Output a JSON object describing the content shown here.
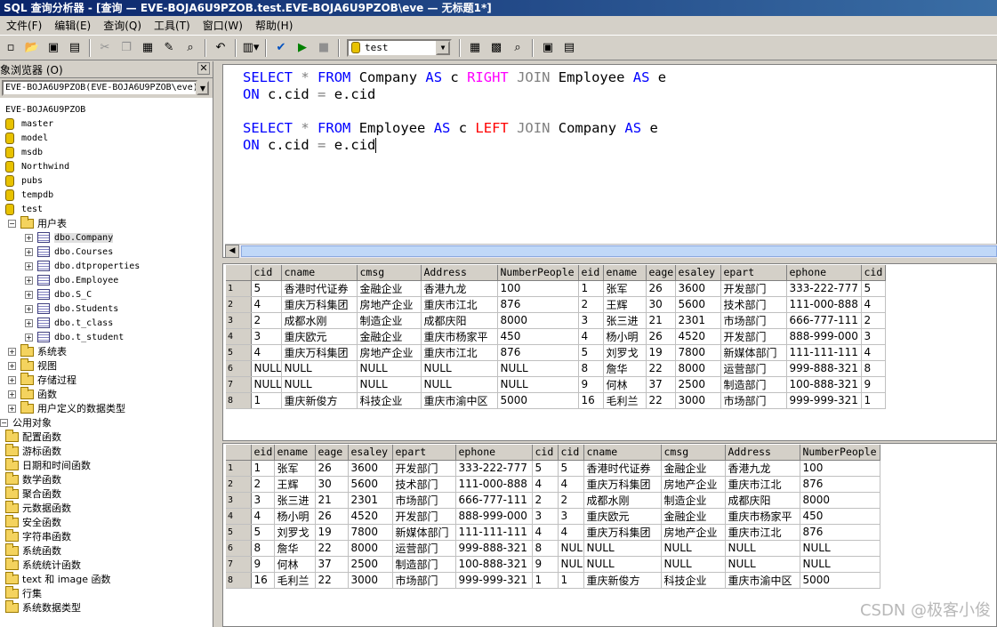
{
  "window": {
    "title": "SQL 查询分析器 - [查询 — EVE-BOJA6U9PZOB.test.EVE-BOJA6U9PZOB\\eve — 无标题1*]"
  },
  "menu": [
    "文件(F)",
    "编辑(E)",
    "查询(Q)",
    "工具(T)",
    "窗口(W)",
    "帮助(H)"
  ],
  "toolbar": {
    "database": "test"
  },
  "browser": {
    "title": "象浏览器 (O)",
    "server_combo": "EVE-BOJA6U9PZOB(EVE-BOJA6U9PZOB\\eve)",
    "server": "EVE-BOJA6U9PZOB",
    "databases": [
      "master",
      "model",
      "msdb",
      "Northwind",
      "pubs",
      "tempdb",
      "test"
    ],
    "user_tables_label": "用户表",
    "tables": [
      "dbo.Company",
      "dbo.Courses",
      "dbo.dtproperties",
      "dbo.Employee",
      "dbo.S_C",
      "dbo.Students",
      "dbo.t_class",
      "dbo.t_student"
    ],
    "db_folders": [
      "系统表",
      "视图",
      "存储过程",
      "函数",
      "用户定义的数据类型"
    ],
    "common_objects": "公用对象",
    "functions": [
      "配置函数",
      "游标函数",
      "日期和时间函数",
      "数学函数",
      "聚合函数",
      "元数据函数",
      "安全函数",
      "字符串函数",
      "系统函数",
      "系统统计函数",
      "text 和 image 函数",
      "行集",
      "系统数据类型"
    ]
  },
  "query": {
    "line1": {
      "k1": "SELECT",
      "star": "*",
      "k2": "FROM",
      "t1": "Company",
      "k3": "AS",
      "a1": "c",
      "k4": "RIGHT",
      "k5": "JOIN",
      "t2": "Employee",
      "k6": "AS",
      "a2": "e"
    },
    "line2": {
      "k1": "ON",
      "cond1": "c.cid",
      "eq": "=",
      "cond2": "e.cid"
    },
    "line3": {
      "k1": "SELECT",
      "star": "*",
      "k2": "FROM",
      "t1": "Employee",
      "k3": "AS",
      "a1": "c",
      "k4": "LEFT",
      "k5": "JOIN",
      "t2": "Company",
      "k6": "AS",
      "a2": "e"
    },
    "line4": {
      "k1": "ON",
      "cond1": "c.cid",
      "eq": "=",
      "cond2": "e.cid"
    }
  },
  "result1": {
    "columns": [
      "cid",
      "cname",
      "cmsg",
      "Address",
      "NumberPeople",
      "eid",
      "ename",
      "eage",
      "esaley",
      "epart",
      "ephone",
      "cid"
    ],
    "rows": [
      [
        "1",
        "5",
        "香港时代证券",
        "金融企业",
        "香港九龙",
        "100",
        "1",
        "张军",
        "26",
        "3600",
        "开发部门",
        "333-222-777",
        "5"
      ],
      [
        "2",
        "4",
        "重庆万科集团",
        "房地产企业",
        "重庆市江北",
        "876",
        "2",
        "王辉",
        "30",
        "5600",
        "技术部门",
        "111-000-888",
        "4"
      ],
      [
        "3",
        "2",
        "成都水刚",
        "制造企业",
        "成都庆阳",
        "8000",
        "3",
        "张三进",
        "21",
        "2301",
        "市场部门",
        "666-777-111",
        "2"
      ],
      [
        "4",
        "3",
        "重庆欧元",
        "金融企业",
        "重庆市杨家平",
        "450",
        "4",
        "杨小明",
        "26",
        "4520",
        "开发部门",
        "888-999-000",
        "3"
      ],
      [
        "5",
        "4",
        "重庆万科集团",
        "房地产企业",
        "重庆市江北",
        "876",
        "5",
        "刘罗戈",
        "19",
        "7800",
        "新媒体部门",
        "111-111-111",
        "4"
      ],
      [
        "6",
        "NULL",
        "NULL",
        "NULL",
        "NULL",
        "NULL",
        "8",
        "詹华",
        "22",
        "8000",
        "运营部门",
        "999-888-321",
        "8"
      ],
      [
        "7",
        "NULL",
        "NULL",
        "NULL",
        "NULL",
        "NULL",
        "9",
        "何林",
        "37",
        "2500",
        "制造部门",
        "100-888-321",
        "9"
      ],
      [
        "8",
        "1",
        "重庆新俊方",
        "科技企业",
        "重庆市渝中区",
        "5000",
        "16",
        "毛利兰",
        "22",
        "3000",
        "市场部门",
        "999-999-321",
        "1"
      ]
    ]
  },
  "result2": {
    "columns": [
      "eid",
      "ename",
      "eage",
      "esaley",
      "epart",
      "ephone",
      "cid",
      "cid",
      "cname",
      "cmsg",
      "Address",
      "NumberPeople"
    ],
    "rows": [
      [
        "1",
        "1",
        "张军",
        "26",
        "3600",
        "开发部门",
        "333-222-777",
        "5",
        "5",
        "香港时代证券",
        "金融企业",
        "香港九龙",
        "100"
      ],
      [
        "2",
        "2",
        "王辉",
        "30",
        "5600",
        "技术部门",
        "111-000-888",
        "4",
        "4",
        "重庆万科集团",
        "房地产企业",
        "重庆市江北",
        "876"
      ],
      [
        "3",
        "3",
        "张三进",
        "21",
        "2301",
        "市场部门",
        "666-777-111",
        "2",
        "2",
        "成都水刚",
        "制造企业",
        "成都庆阳",
        "8000"
      ],
      [
        "4",
        "4",
        "杨小明",
        "26",
        "4520",
        "开发部门",
        "888-999-000",
        "3",
        "3",
        "重庆欧元",
        "金融企业",
        "重庆市杨家平",
        "450"
      ],
      [
        "5",
        "5",
        "刘罗戈",
        "19",
        "7800",
        "新媒体部门",
        "111-111-111",
        "4",
        "4",
        "重庆万科集团",
        "房地产企业",
        "重庆市江北",
        "876"
      ],
      [
        "6",
        "8",
        "詹华",
        "22",
        "8000",
        "运营部门",
        "999-888-321",
        "8",
        "NULL",
        "NULL",
        "NULL",
        "NULL",
        "NULL"
      ],
      [
        "7",
        "9",
        "何林",
        "37",
        "2500",
        "制造部门",
        "100-888-321",
        "9",
        "NULL",
        "NULL",
        "NULL",
        "NULL",
        "NULL"
      ],
      [
        "8",
        "16",
        "毛利兰",
        "22",
        "3000",
        "市场部门",
        "999-999-321",
        "1",
        "1",
        "重庆新俊方",
        "科技企业",
        "重庆市渝中区",
        "5000"
      ]
    ]
  },
  "watermark": "CSDN @极客小俊"
}
